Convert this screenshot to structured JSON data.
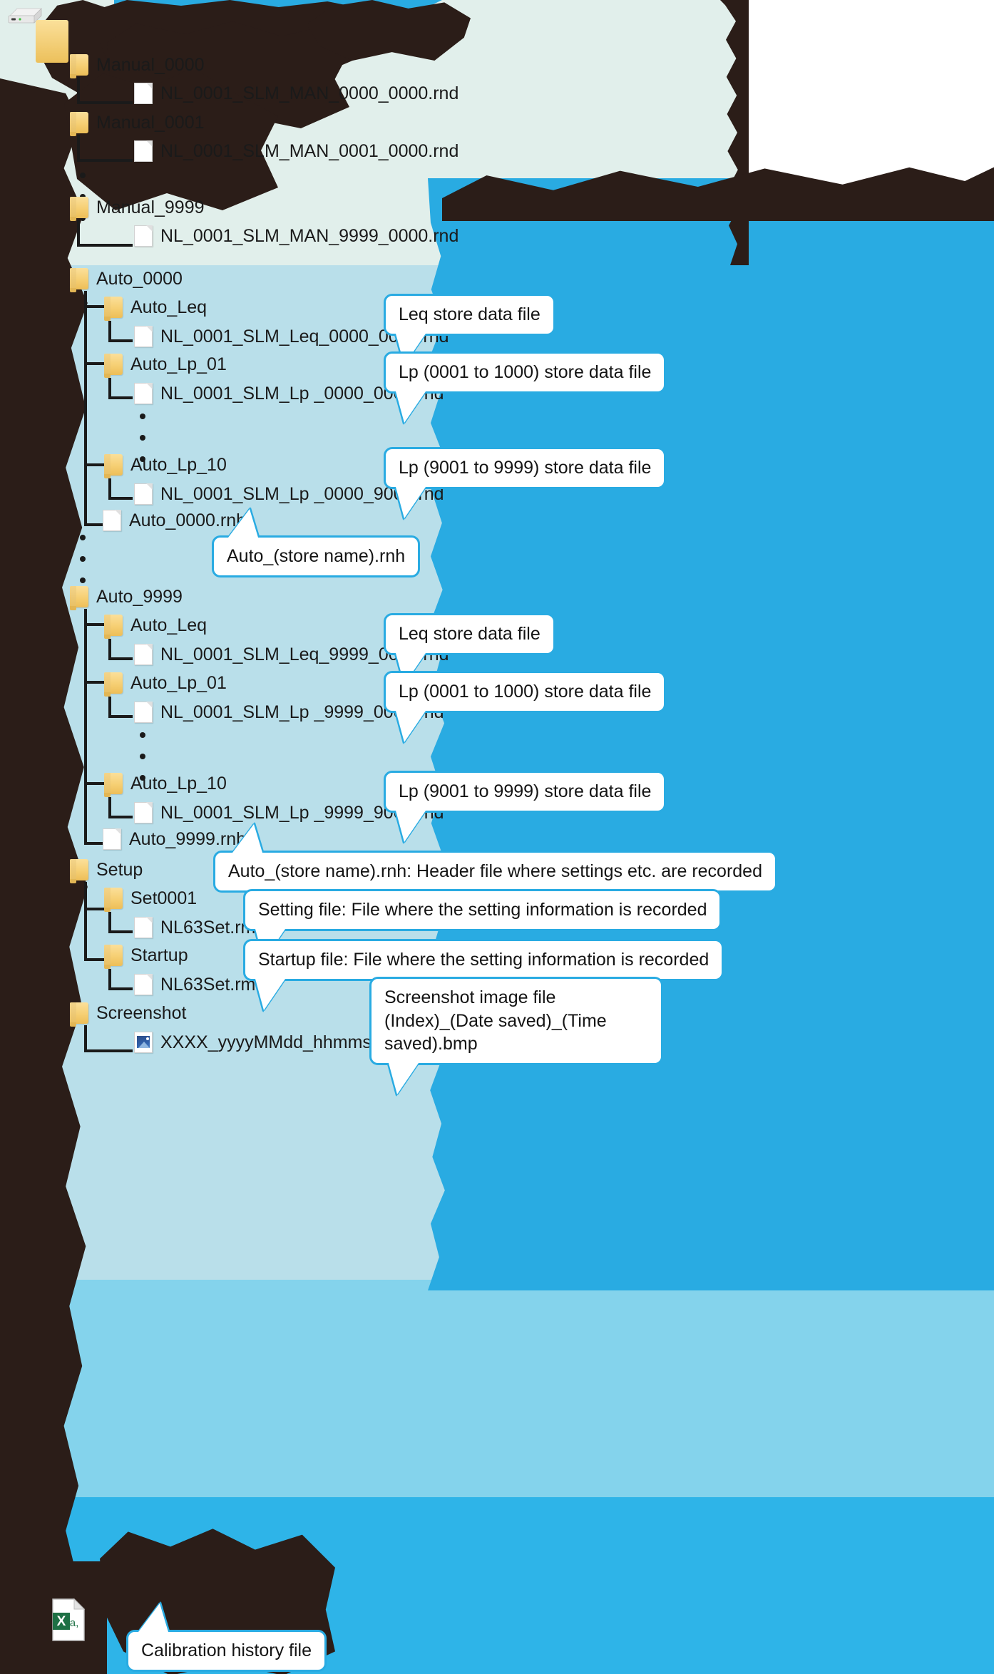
{
  "colors": {
    "band_mint": "#e1efeb",
    "band_light_blue": "#b9dfea",
    "band_mid_blue": "#84d3ec",
    "band_cyan": "#2eb4e8",
    "accent_cyan": "#29abe2",
    "redaction": "#2b1d18",
    "folder_yellow": "#f6cf73",
    "text": "#1a1a1a"
  },
  "icons": {
    "drive": "drive-icon",
    "folder": "folder-icon",
    "file": "file-icon",
    "image_file": "image-file-icon",
    "excel_file": "excel-file-icon"
  },
  "tree": {
    "manual": [
      {
        "type": "folder",
        "label": "Manual_0000"
      },
      {
        "type": "file",
        "label": "NL_0001_SLM_MAN_0000_0000.rnd"
      },
      {
        "type": "folder",
        "label": "Manual_0001"
      },
      {
        "type": "file",
        "label": "NL_0001_SLM_MAN_0001_0000.rnd"
      },
      {
        "type": "folder",
        "label": "Manual_9999"
      },
      {
        "type": "file",
        "label": "NL_0001_SLM_MAN_9999_0000.rnd"
      }
    ],
    "auto_0000": [
      {
        "type": "folder",
        "label": "Auto_0000"
      },
      {
        "type": "folder",
        "label": "Auto_Leq"
      },
      {
        "type": "file",
        "label": "NL_0001_SLM_Leq_0000_0001.rnd"
      },
      {
        "type": "folder",
        "label": "Auto_Lp_01"
      },
      {
        "type": "file",
        "label": "NL_0001_SLM_Lp _0000_0001.rnd"
      },
      {
        "type": "folder",
        "label": "Auto_Lp_10"
      },
      {
        "type": "file",
        "label": "NL_0001_SLM_Lp _0000_9001.rnd"
      },
      {
        "type": "file",
        "label": "Auto_0000.rnh"
      }
    ],
    "auto_9999": [
      {
        "type": "folder",
        "label": "Auto_9999"
      },
      {
        "type": "folder",
        "label": "Auto_Leq"
      },
      {
        "type": "file",
        "label": "NL_0001_SLM_Leq_9999_0001.rnd"
      },
      {
        "type": "folder",
        "label": "Auto_Lp_01"
      },
      {
        "type": "file",
        "label": "NL_0001_SLM_Lp _9999_0001.rnd"
      },
      {
        "type": "folder",
        "label": "Auto_Lp_10"
      },
      {
        "type": "file",
        "label": "NL_0001_SLM_Lp _9999_9001.rnd"
      },
      {
        "type": "file",
        "label": "Auto_9999.rnh"
      }
    ],
    "setup": [
      {
        "type": "folder",
        "label": "Setup"
      },
      {
        "type": "folder",
        "label": "Set0001"
      },
      {
        "type": "file",
        "label": "NL63Set.rms"
      },
      {
        "type": "folder",
        "label": "Startup"
      },
      {
        "type": "file",
        "label": "NL63Set.rms"
      }
    ],
    "screenshot": [
      {
        "type": "folder",
        "label": "Screenshot"
      },
      {
        "type": "image",
        "label": "XXXX_yyyyMMdd_hhmmss.bmp"
      }
    ]
  },
  "callouts": {
    "leq_0000": "Leq store data file",
    "lp01_0000": "Lp (0001 to 1000) store data file",
    "lp10_0000": "Lp (9001 to 9999) store data file",
    "rnh_0000": "Auto_(store name).rnh",
    "leq_9999": "Leq store data file",
    "lp01_9999": "Lp (0001 to 1000) store data file",
    "lp10_9999": "Lp (9001 to 9999) store data file",
    "rnh_header": "Auto_(store name).rnh: Header file where settings etc. are recorded",
    "setting_file": "Setting file: File where the setting information is recorded",
    "startup_file": "Startup file: File where the setting information is recorded",
    "screenshot_l1": "Screenshot image file",
    "screenshot_l2": "(Index)_(Date saved)_(Time saved).bmp",
    "calibration": "Calibration history file"
  }
}
